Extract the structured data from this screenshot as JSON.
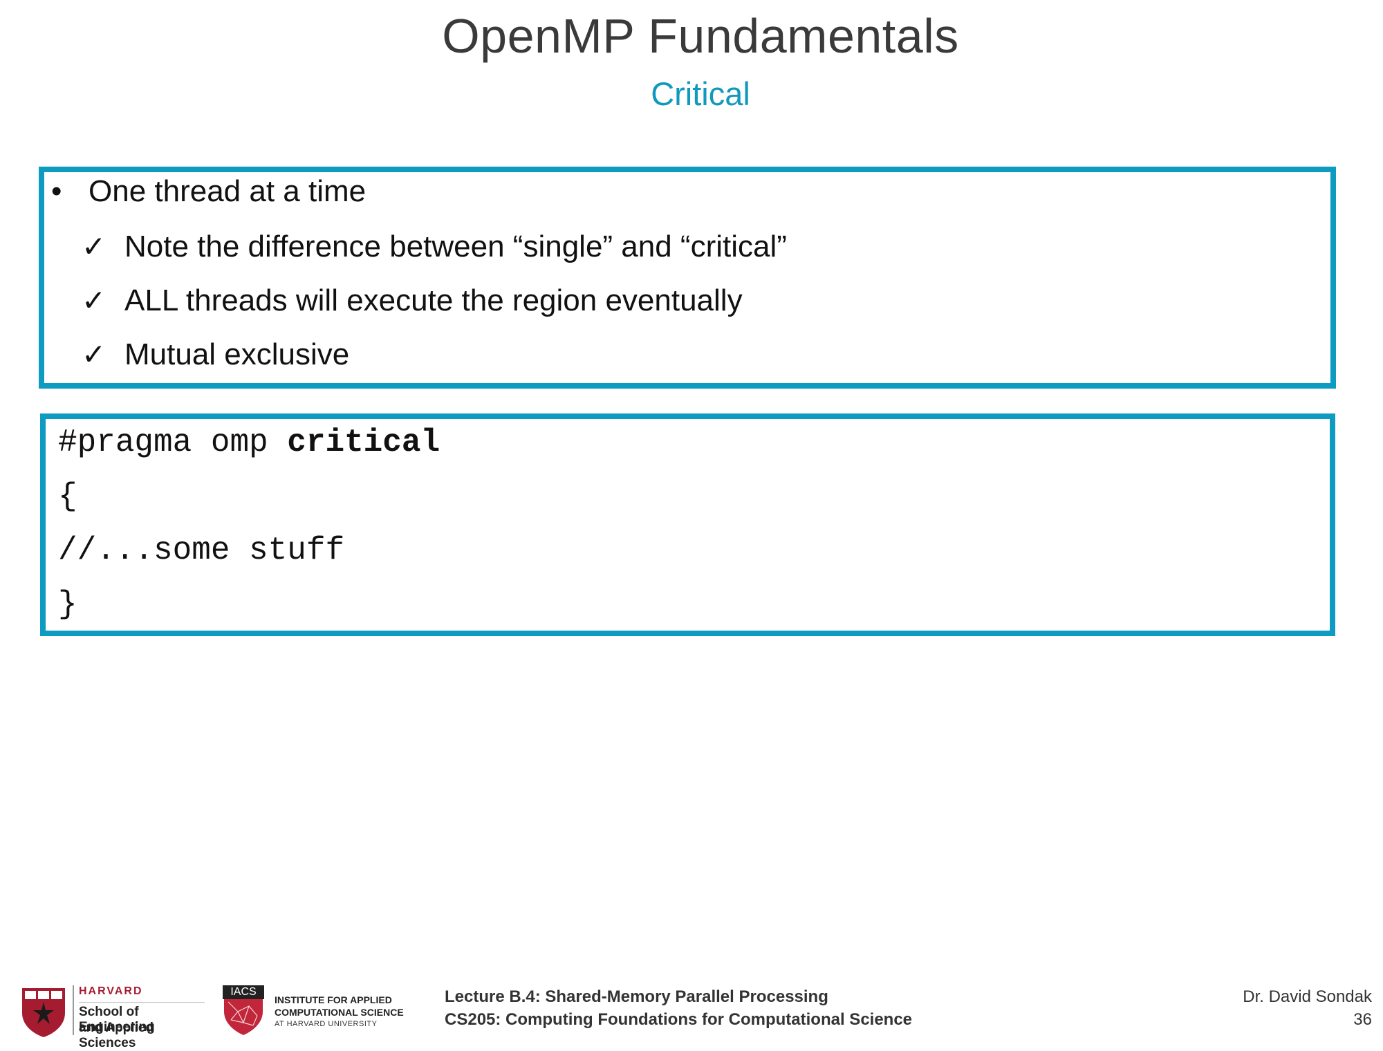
{
  "slide": {
    "title": "OpenMP Fundamentals",
    "subtitle": "Critical"
  },
  "bullets": {
    "main": "One thread at a time",
    "bullet_glyph": "•",
    "check_glyph": "✓",
    "sub": [
      "Note the difference between “single” and “critical”",
      "ALL threads will execute the region eventually",
      "Mutual exclusive"
    ]
  },
  "code": {
    "line1_prefix": "#pragma omp ",
    "line1_keyword": "critical",
    "line2": "{",
    "line3": "//...some stuff",
    "line4": "}"
  },
  "footer": {
    "harvard_logo": {
      "name": "HARVARD",
      "line1": "School of Engineering",
      "line2": "and Applied Sciences"
    },
    "iacs_logo": {
      "badge": "IACS",
      "line1": "INSTITUTE FOR APPLIED",
      "line2": "COMPUTATIONAL SCIENCE",
      "line3": "AT HARVARD UNIVERSITY"
    },
    "lecture": "Lecture B.4: Shared-Memory Parallel Processing",
    "course": "CS205: Computing Foundations for Computational Science",
    "author": "Dr. David Sondak",
    "page": "36"
  },
  "colors": {
    "accent": "#0e9bc2",
    "subtitle": "#1199bb",
    "title": "#3a3a3a",
    "harvard_red": "#a51c30"
  }
}
